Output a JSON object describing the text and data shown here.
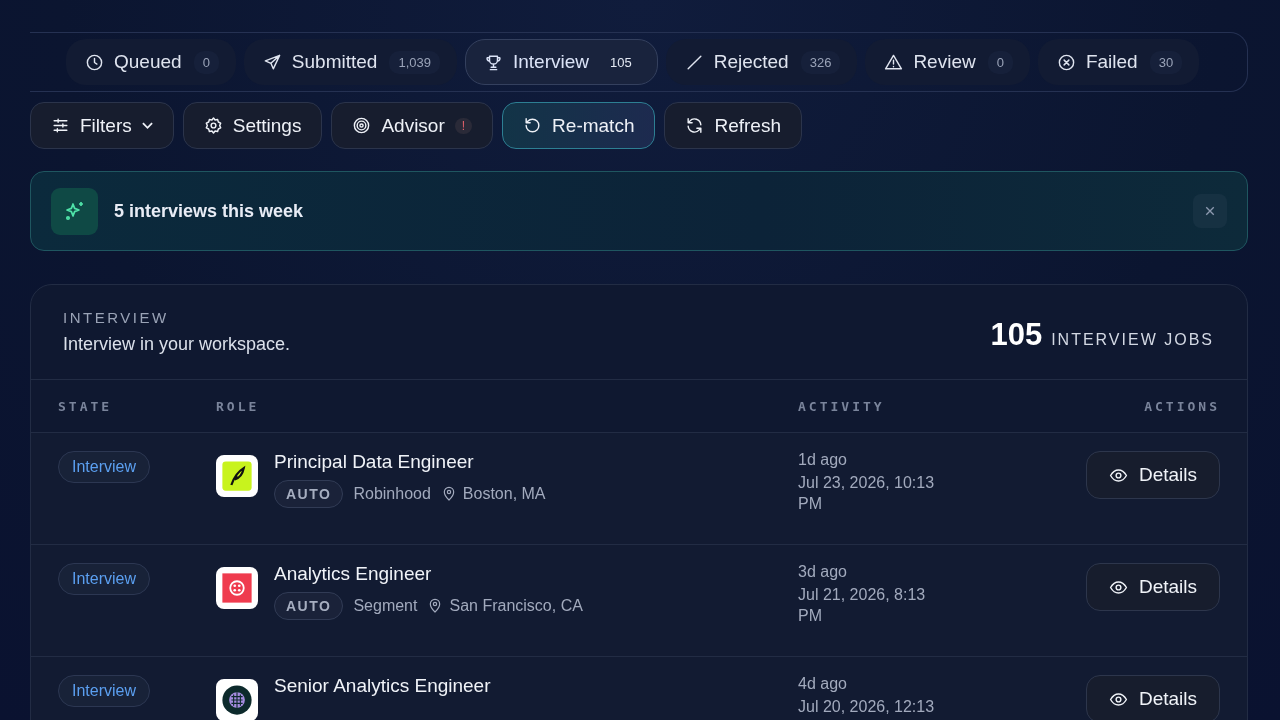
{
  "tabs": [
    {
      "label": "Queued",
      "count": "0",
      "selected": false
    },
    {
      "label": "Submitted",
      "count": "1,039",
      "selected": false
    },
    {
      "label": "Interview",
      "count": "105",
      "selected": true
    },
    {
      "label": "Rejected",
      "count": "326",
      "selected": false
    },
    {
      "label": "Review",
      "count": "0",
      "selected": false
    },
    {
      "label": "Failed",
      "count": "30",
      "selected": false
    }
  ],
  "toolbar": [
    {
      "label": "Filters",
      "dropdown": true,
      "active": false
    },
    {
      "label": "Settings",
      "dropdown": false,
      "active": false
    },
    {
      "label": "Advisor",
      "badge": "!",
      "dropdown": false,
      "active": false
    },
    {
      "label": "Re-match",
      "dropdown": false,
      "active": true
    },
    {
      "label": "Refresh",
      "dropdown": false,
      "active": false
    }
  ],
  "notice": {
    "text": "5 interviews this week"
  },
  "panel": {
    "eyebrow": "INTERVIEW",
    "subtitle": "Interview in your workspace.",
    "count": "105",
    "count_label": "INTERVIEW JOBS",
    "columns": [
      "STATE",
      "ROLE",
      "ACTIVITY",
      "ACTIONS"
    ],
    "rows": [
      {
        "state": "Interview",
        "title": "Principal Data Engineer",
        "tag": "AUTO",
        "company": "Robinhood",
        "location": "Boston, MA",
        "ago": "1d ago",
        "date": "Jul 23, 2026, 10:13 PM",
        "action": "Details"
      },
      {
        "state": "Interview",
        "title": "Analytics Engineer",
        "tag": "AUTO",
        "company": "Segment",
        "location": "San Francisco, CA",
        "ago": "3d ago",
        "date": "Jul 21, 2026, 8:13 PM",
        "action": "Details"
      },
      {
        "state": "Interview",
        "title": "Senior Analytics Engineer",
        "ago": "4d ago",
        "date": "Jul 20, 2026, 12:13",
        "action": "Details"
      }
    ]
  }
}
